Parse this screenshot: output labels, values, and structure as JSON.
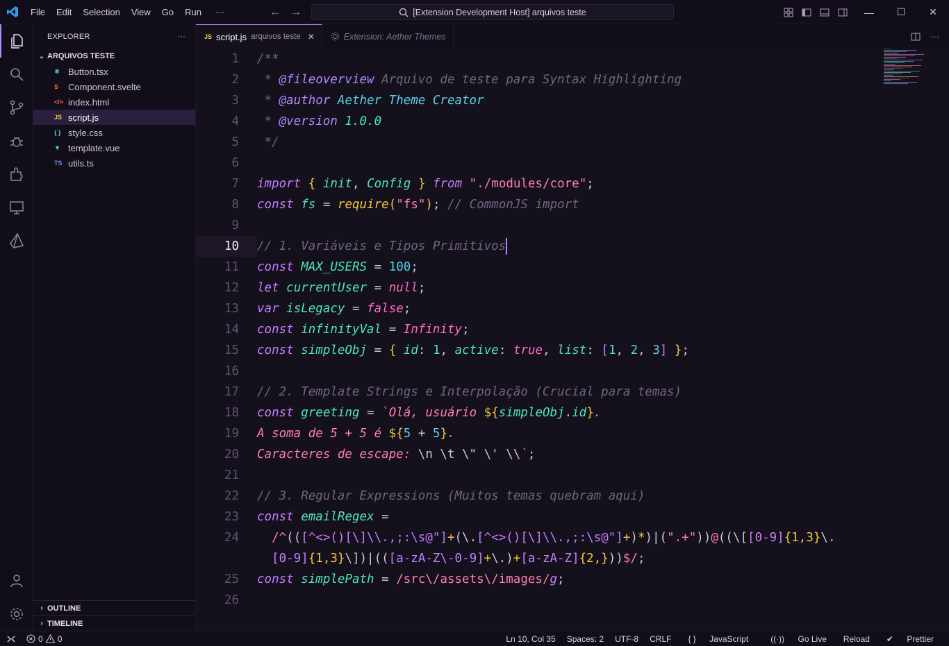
{
  "titlebar": {
    "menu": [
      "File",
      "Edit",
      "Selection",
      "View",
      "Go",
      "Run",
      "···"
    ],
    "search": "[Extension Development Host] arquivos teste"
  },
  "explorer": {
    "title": "EXPLORER",
    "more": "···",
    "folder": "ARQUIVOS TESTE",
    "files": [
      {
        "name": "Button.tsx",
        "icon": "react-icon",
        "color": "#5ad1e6"
      },
      {
        "name": "Component.svelte",
        "icon": "svelte-icon",
        "color": "#ff6a3d"
      },
      {
        "name": "index.html",
        "icon": "html-icon",
        "color": "#ff6a3d"
      },
      {
        "name": "script.js",
        "icon": "js-icon",
        "color": "#f5c542"
      },
      {
        "name": "style.css",
        "icon": "css-icon",
        "color": "#5ad1e6"
      },
      {
        "name": "template.vue",
        "icon": "vue-icon",
        "color": "#4ee6b4"
      },
      {
        "name": "utils.ts",
        "icon": "ts-icon",
        "color": "#5a8ee6"
      }
    ],
    "outline": "OUTLINE",
    "timeline": "TIMELINE"
  },
  "tabs": {
    "active_icon": "JS",
    "active_name": "script.js",
    "active_desc": "arquivos teste",
    "close": "✕",
    "inactive_name": "Extension: Aether Themes"
  },
  "editor": {
    "line_numbers": [
      "1",
      "2",
      "3",
      "4",
      "5",
      "6",
      "7",
      "8",
      "9",
      "10",
      "11",
      "12",
      "13",
      "14",
      "15",
      "16",
      "17",
      "18",
      "19",
      "20",
      "21",
      "22",
      "23",
      "24",
      "",
      "25",
      "26"
    ],
    "current_line": "10"
  },
  "statusbar": {
    "errors": "0",
    "warnings": "0",
    "position": "Ln 10, Col 35",
    "spaces": "Spaces: 2",
    "encoding": "UTF-8",
    "eol": "CRLF",
    "language_braces": "{ }",
    "language": "JavaScript",
    "golive": "Go Live",
    "reload": "Reload",
    "prettier": "Prettier"
  },
  "colors": {
    "accent": "#b388ff",
    "background": "#14101c",
    "sidebar": "#120e19"
  }
}
